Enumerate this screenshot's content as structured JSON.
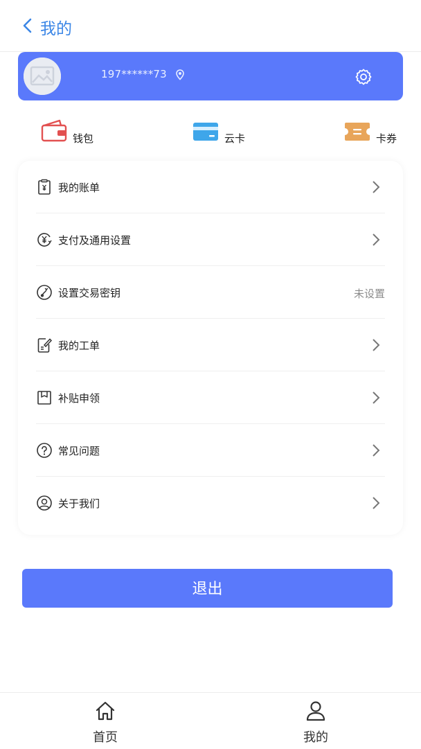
{
  "header": {
    "title": "我的"
  },
  "profile": {
    "phone": "197******73"
  },
  "quick": [
    {
      "label": "钱包",
      "icon": "wallet-icon"
    },
    {
      "label": "云卡",
      "icon": "card-icon"
    },
    {
      "label": "卡券",
      "icon": "ticket-icon"
    }
  ],
  "menu": [
    {
      "label": "我的账单",
      "icon": "bill-icon"
    },
    {
      "label": "支付及通用设置",
      "icon": "yen-circle-icon"
    },
    {
      "label": "设置交易密钥",
      "icon": "key-circle-icon",
      "value": "未设置"
    },
    {
      "label": "我的工单",
      "icon": "edit-doc-icon"
    },
    {
      "label": "补贴申领",
      "icon": "subsidy-box-icon"
    },
    {
      "label": "常见问题",
      "icon": "question-circle-icon"
    },
    {
      "label": "关于我们",
      "icon": "user-circle-icon"
    }
  ],
  "logout": {
    "label": "退出"
  },
  "tabbar": [
    {
      "label": "首页",
      "icon": "home-icon"
    },
    {
      "label": "我的",
      "icon": "person-icon"
    }
  ],
  "colors": {
    "accent": "#5a79fb",
    "header_title": "#3b86e6",
    "wallet": "#e25050",
    "card": "#3ea6ea",
    "ticket": "#e8a55a"
  }
}
